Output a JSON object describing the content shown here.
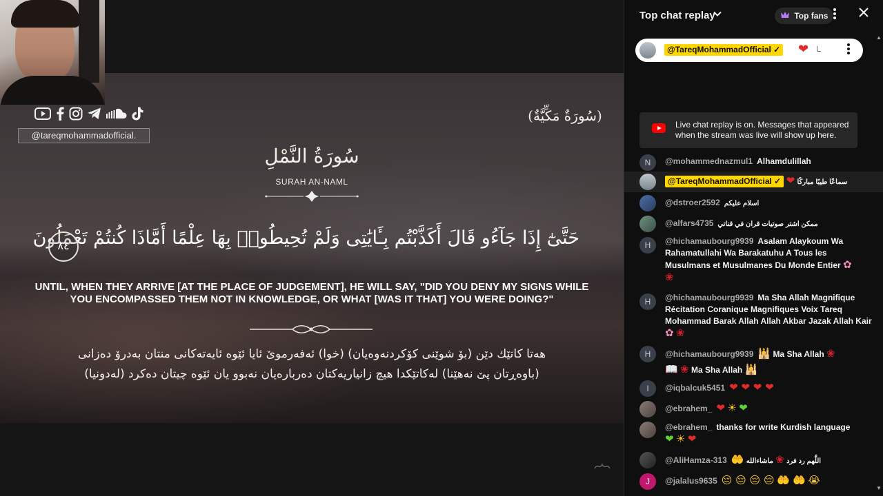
{
  "video": {
    "handle": "@tareqmohammadofficial.",
    "surah_type": "(سُورَةٌ مَكِّيَّةٌ)",
    "surah_arabic": "سُورَةُ النَّمْلِ",
    "surah_english": "SURAH AN-NAML",
    "verse_arabic": "حَتَّىٰٓ إِذَا جَآءُو قَالَ أَكَذَّبْتُم بِـَٔايَٰتِى وَلَمْ تُحِيطُوا۟ بِهَا عِلْمًا أَمَّاذَا كُنتُمْ تَعْمَلُونَ",
    "ayah_number": "٨٤",
    "verse_english": "UNTIL, WHEN THEY ARRIVE [AT THE PLACE OF JUDGEMENT], HE WILL SAY, \"DID YOU DENY MY SIGNS WHILE YOU ENCOMPASSED THEM NOT IN KNOWLEDGE, OR WHAT [WAS IT THAT] YOU WERE DOING?\"",
    "verse_kurdish_1": "هەتا کاتێك دێن (بۆ شوێنی کۆکردنەوەیان) (خوا) ئەفەرموێ ئایا ئێوە ئایەتەکانی منتان بەدرۆ دەزانی",
    "verse_kurdish_2": "(باوەڕتان پێ نەهێنا) لەکاتێکدا هیچ زانیاریەکتان دەربارەیان نەبوو یان ئێوە چیتان دەکرد (لەدونیا)",
    "social_icons": [
      "youtube-icon",
      "facebook-icon",
      "instagram-icon",
      "telegram-icon",
      "soundcloud-icon",
      "tiktok-icon"
    ]
  },
  "chat": {
    "title": "Top chat replay",
    "top_fans_label": "Top fans",
    "pinned": {
      "author": "@TareqMohammadOfficial",
      "text": "ـا"
    },
    "replay_banner": "Live chat replay is on. Messages that appeared when the stream was live will show up here.",
    "messages": [
      {
        "avatar_letter": "N",
        "author": "@mohammednazmul1",
        "text": "Alhamdulillah"
      },
      {
        "author": "@TareqMohammadOfficial",
        "text": "سماعًا طيبًا مباركًا"
      },
      {
        "author": "@dstroer2592",
        "text": "اسلام عليكم"
      },
      {
        "author": "@alfars4735",
        "text": "ممكن اشتر صوتيات قران في قناتي"
      },
      {
        "avatar_letter": "H",
        "author": "@hichamaubourg9939",
        "text": "Asalam Alaykoum Wa Rahamatullahi Wa Barakatuhu A Tous les Musulmans et Musulmanes Du Monde Entier"
      },
      {
        "avatar_letter": "H",
        "author": "@hichamaubourg9939",
        "text": "Ma Sha Allah Magnifique Récitation Coranique Magnifiques Voix Tareq Mohammad Barak Allah Allah Akbar Jazak Allah Kair"
      },
      {
        "avatar_letter": "H",
        "author": "@hichamaubourg9939",
        "text_a": "Ma Sha Allah",
        "text_b": "Ma Sha Allah"
      },
      {
        "avatar_letter": "I",
        "author": "@iqbalcuk5451",
        "text": ""
      },
      {
        "author": "@ebrahem_",
        "text": ""
      },
      {
        "author": "@ebrahem_",
        "text": "thanks for write Kurdish language"
      },
      {
        "author": "@AliHamza-313",
        "text_a": "اللَّهم رد فرد",
        "text_b": "ماشاءالله"
      },
      {
        "avatar_letter": "J",
        "author": "@jalalus9635",
        "text": ""
      }
    ]
  },
  "colors": {
    "owner_badge": "#ffd600",
    "chat_bg": "#0f0f0f",
    "heart": "#e02b2b",
    "youtube_red": "#ff0000"
  }
}
